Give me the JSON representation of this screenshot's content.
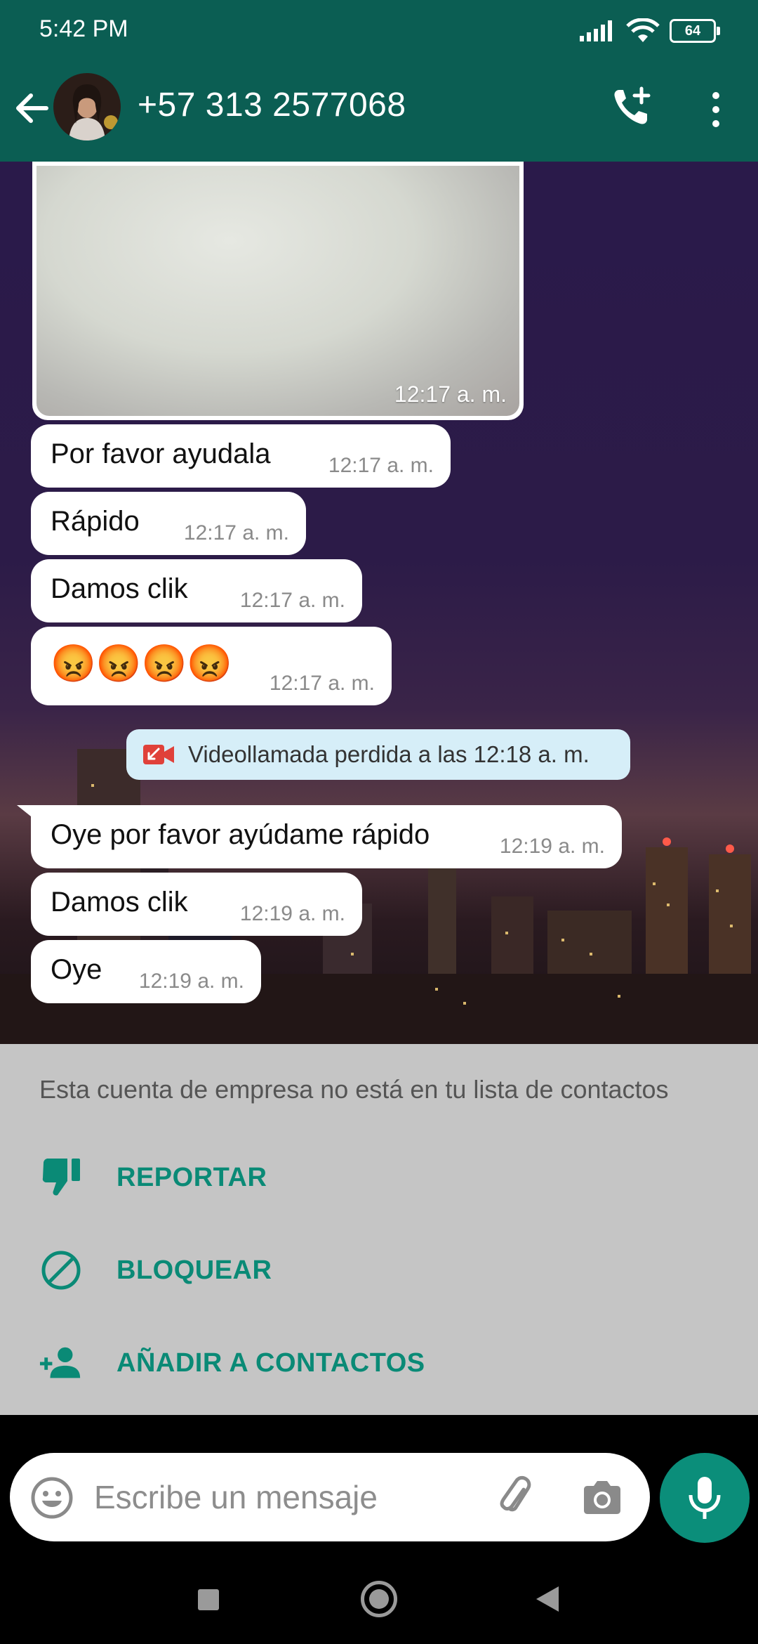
{
  "status_bar": {
    "time": "5:42 PM",
    "battery": "64"
  },
  "header": {
    "contact": "+57 313 2577068"
  },
  "chat": {
    "media_time": "12:17 a. m.",
    "messages": [
      {
        "text": "Por favor ayudala",
        "time": "12:17 a. m."
      },
      {
        "text": "Rápido",
        "time": "12:17 a. m."
      },
      {
        "text": "Damos clik",
        "time": "12:17 a. m."
      },
      {
        "text": "😡😡😡😡",
        "time": "12:17 a. m."
      },
      {
        "text": "Oye por favor ayúdame rápido",
        "time": "12:19 a. m."
      },
      {
        "text": "Damos clik",
        "time": "12:19 a. m."
      },
      {
        "text": "Oye",
        "time": "12:19 a. m."
      }
    ],
    "system_message": "Videollamada perdida a las 12:18 a. m."
  },
  "business_panel": {
    "info": "Esta cuenta de empresa no está en tu lista de contactos",
    "actions": [
      {
        "label": "REPORTAR",
        "icon": "thumbs-down-icon"
      },
      {
        "label": "BLOQUEAR",
        "icon": "block-icon"
      },
      {
        "label": "AÑADIR A CONTACTOS",
        "icon": "add-person-icon"
      }
    ]
  },
  "composer": {
    "placeholder": "Escribe un mensaje"
  },
  "colors": {
    "header": "#0b5e53",
    "accent": "#0a8a76",
    "mic": "#0b8e7a"
  }
}
